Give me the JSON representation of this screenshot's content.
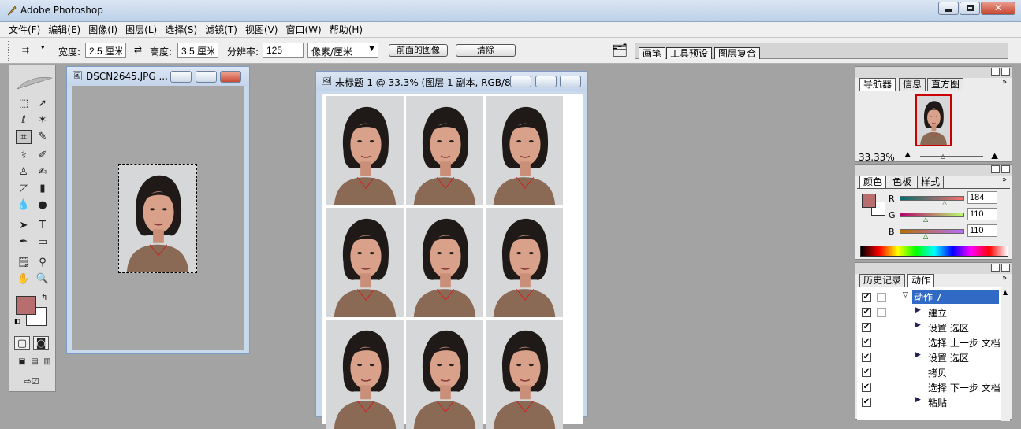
{
  "app": {
    "title": "Adobe Photoshop"
  },
  "menu": [
    "文件(F)",
    "编辑(E)",
    "图像(I)",
    "图层(L)",
    "选择(S)",
    "滤镜(T)",
    "视图(V)",
    "窗口(W)",
    "帮助(H)"
  ],
  "options": {
    "width_label": "宽度:",
    "width_value": "2.5 厘米",
    "height_label": "高度:",
    "height_value": "3.5 厘米",
    "resolution_label": "分辨率:",
    "resolution_value": "125",
    "unit_value": "像素/厘米",
    "front_image_btn": "前面的图像",
    "clear_btn": "清除"
  },
  "palette_well_tabs": [
    "画笔",
    "工具预设",
    "图层复合"
  ],
  "doc1": {
    "title": "DSCN2645.JPG ..."
  },
  "doc2": {
    "title": "未标题-1 @ 33.3% (图层 1 副本, RGB/8)"
  },
  "navigator": {
    "tabs": [
      "导航器",
      "信息",
      "直方图"
    ],
    "zoom": "33.33%"
  },
  "color": {
    "tabs": [
      "颜色",
      "色板",
      "样式"
    ],
    "r_label": "R",
    "g_label": "G",
    "b_label": "B",
    "r": "184",
    "g": "110",
    "b": "110",
    "swatch": "#b86e6e"
  },
  "history": {
    "tabs": [
      "历史记录",
      "动作"
    ],
    "items": [
      "动作 7",
      "建立",
      "设置 选区",
      "选择 上一步 文档",
      "设置 选区",
      "拷贝",
      "选择 下一步 文档",
      "粘贴"
    ]
  },
  "colors": {
    "foreground": "#b86e6e",
    "background": "#ffffff"
  }
}
